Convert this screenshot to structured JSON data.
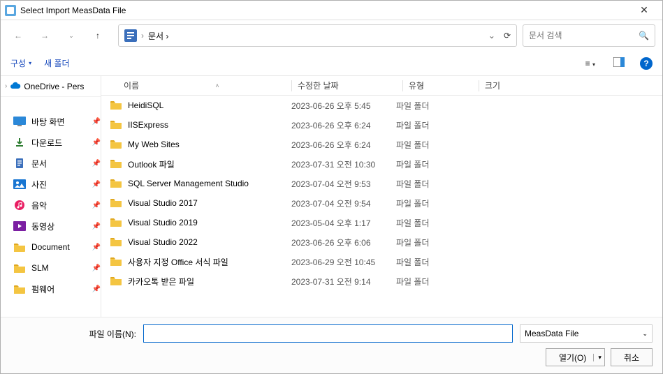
{
  "window": {
    "title": "Select Import MeasData File"
  },
  "address": {
    "path": "문서  ›"
  },
  "search": {
    "placeholder": "문서 검색"
  },
  "toolbar": {
    "organize": "구성",
    "newfolder": "새 폴더"
  },
  "sidebar": {
    "onedrive": "OneDrive - Pers",
    "quick": [
      {
        "label": "바탕 화면",
        "icon": "desktop",
        "color": "#2b88d8"
      },
      {
        "label": "다운로드",
        "icon": "download",
        "color": "#2e7d32"
      },
      {
        "label": "문서",
        "icon": "document",
        "color": "#3b6fbb"
      },
      {
        "label": "사진",
        "icon": "photo",
        "color": "#1976d2"
      },
      {
        "label": "음악",
        "icon": "music",
        "color": "#e91e63"
      },
      {
        "label": "동영상",
        "icon": "video",
        "color": "#7b1fa2"
      },
      {
        "label": "Document",
        "icon": "folder",
        "color": "#f4c542"
      },
      {
        "label": "SLM",
        "icon": "folder",
        "color": "#f4c542"
      },
      {
        "label": "펌웨어",
        "icon": "folder",
        "color": "#f4c542"
      }
    ]
  },
  "columns": {
    "name": "이름",
    "date": "수정한 날짜",
    "type": "유형",
    "size": "크기"
  },
  "files": [
    {
      "name": "HeidiSQL",
      "date": "2023-06-26 오후 5:45",
      "type": "파일 폴더"
    },
    {
      "name": "IISExpress",
      "date": "2023-06-26 오후 6:24",
      "type": "파일 폴더"
    },
    {
      "name": "My Web Sites",
      "date": "2023-06-26 오후 6:24",
      "type": "파일 폴더"
    },
    {
      "name": "Outlook 파일",
      "date": "2023-07-31 오전 10:30",
      "type": "파일 폴더"
    },
    {
      "name": "SQL Server Management Studio",
      "date": "2023-07-04 오전 9:53",
      "type": "파일 폴더"
    },
    {
      "name": "Visual Studio 2017",
      "date": "2023-07-04 오전 9:54",
      "type": "파일 폴더"
    },
    {
      "name": "Visual Studio 2019",
      "date": "2023-05-04 오후 1:17",
      "type": "파일 폴더"
    },
    {
      "name": "Visual Studio 2022",
      "date": "2023-06-26 오후 6:06",
      "type": "파일 폴더"
    },
    {
      "name": "사용자 지정 Office 서식 파일",
      "date": "2023-06-29 오전 10:45",
      "type": "파일 폴더"
    },
    {
      "name": "카카오톡 받은 파일",
      "date": "2023-07-31 오전 9:14",
      "type": "파일 폴더"
    }
  ],
  "footer": {
    "filename_label": "파일 이름(N):",
    "filter": "MeasData File",
    "open": "열기(O)",
    "cancel": "취소"
  }
}
